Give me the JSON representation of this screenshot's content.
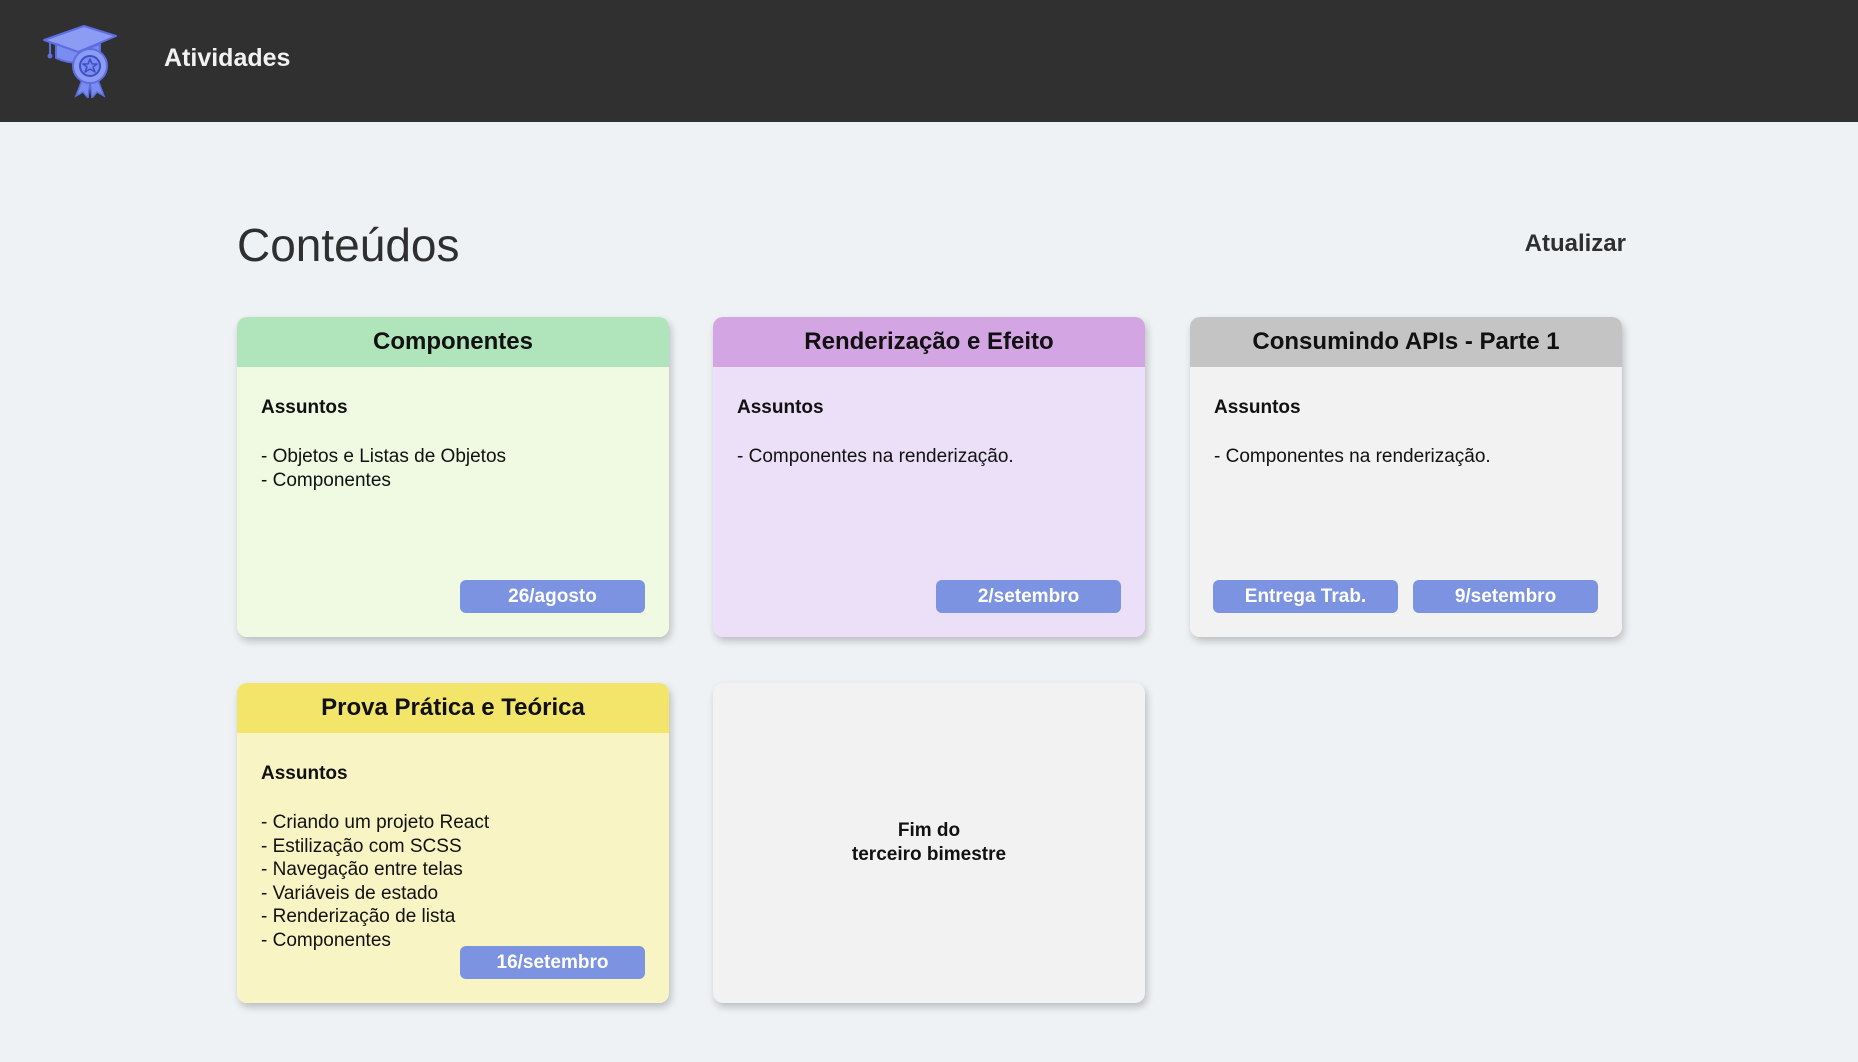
{
  "header": {
    "logo_icon": "graduation-cap-award-icon",
    "title": "Atividades"
  },
  "main": {
    "title": "Conteúdos",
    "refresh_label": "Atualizar"
  },
  "cards": [
    {
      "title": "Componentes",
      "subjects_label": "Assuntos",
      "topics": [
        "- Objetos e Listas de Objetos",
        "- Componentes"
      ],
      "badges": [
        "26/agosto"
      ],
      "header_color": "#b0e4bb",
      "body_color": "#f0fae3"
    },
    {
      "title": "Renderização e Efeito",
      "subjects_label": "Assuntos",
      "topics": [
        "- Componentes na renderização."
      ],
      "badges": [
        "2/setembro"
      ],
      "header_color": "#d3a5e3",
      "body_color": "#ebe0f8"
    },
    {
      "title": "Consumindo APIs - Parte 1",
      "subjects_label": "Assuntos",
      "topics": [
        "- Componentes na renderização."
      ],
      "badges": [
        "Entrega Trab.",
        "9/setembro"
      ],
      "header_color": "#c4c4c4",
      "body_color": "#f2f2f2"
    },
    {
      "title": "Prova Prática e Teórica",
      "subjects_label": "Assuntos",
      "topics": [
        "- Criando um projeto React",
        "- Estilização com SCSS",
        "- Navegação entre telas",
        "- Variáveis de estado",
        "- Renderização de lista",
        "- Componentes"
      ],
      "badges": [
        "16/setembro"
      ],
      "header_color": "#f2e56a",
      "body_color": "#f9f4c3"
    }
  ],
  "end_card": {
    "line1": "Fim do",
    "line2": "terceiro bimestre"
  },
  "colors": {
    "topbar": "#303030",
    "background": "#eff2f5",
    "badge": "#7b93e0",
    "logo": "#7b8cf0"
  }
}
